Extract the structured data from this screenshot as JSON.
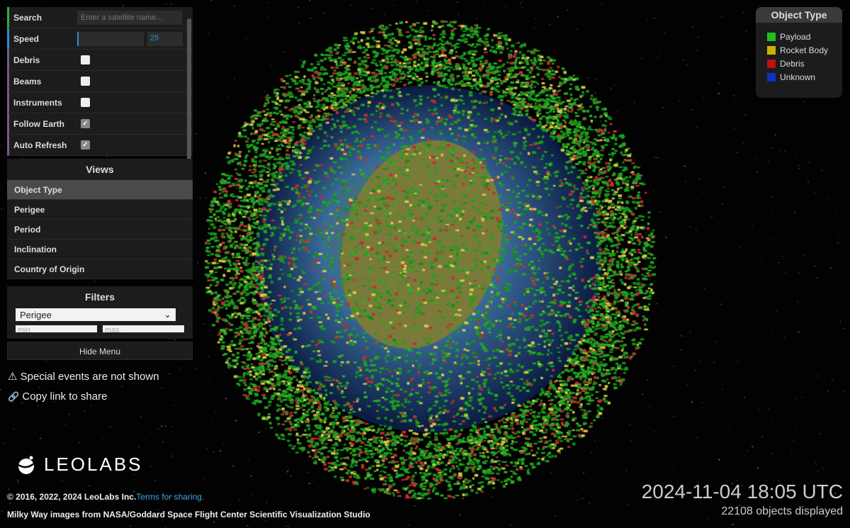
{
  "controls": {
    "search_label": "Search",
    "search_placeholder": "Enter a satellite name...",
    "speed_label": "Speed",
    "speed_value": "25",
    "toggles": [
      {
        "label": "Debris",
        "checked": false
      },
      {
        "label": "Beams",
        "checked": false
      },
      {
        "label": "Instruments",
        "checked": false
      },
      {
        "label": "Follow Earth",
        "checked": true
      },
      {
        "label": "Auto Refresh",
        "checked": true
      }
    ]
  },
  "views": {
    "title": "Views",
    "items": [
      "Object Type",
      "Perigee",
      "Period",
      "Inclination",
      "Country of Origin"
    ],
    "selected": "Object Type"
  },
  "filters": {
    "title": "Filters",
    "selected": "Perigee",
    "min_placeholder": "min",
    "max_placeholder": "max"
  },
  "hide_menu": "Hide Menu",
  "notes": {
    "special": "Special events are not shown",
    "copy": "Copy link to share"
  },
  "legend": {
    "title": "Object Type",
    "items": [
      {
        "label": "Payload",
        "color": "#1fbf1f"
      },
      {
        "label": "Rocket Body",
        "color": "#c8b400"
      },
      {
        "label": "Debris",
        "color": "#c01010"
      },
      {
        "label": "Unknown",
        "color": "#1030c8"
      }
    ]
  },
  "logo": "LEOLABS",
  "footer": {
    "copyright": "© 2016, 2022, 2024 LeoLabs Inc.",
    "terms": "Terms for sharing.",
    "credit": "Milky Way images from NASA/Goddard Space Flight Center Scientific Visualization Studio"
  },
  "time": "2024-11-04 18:05 UTC",
  "count": "22108 objects displayed"
}
